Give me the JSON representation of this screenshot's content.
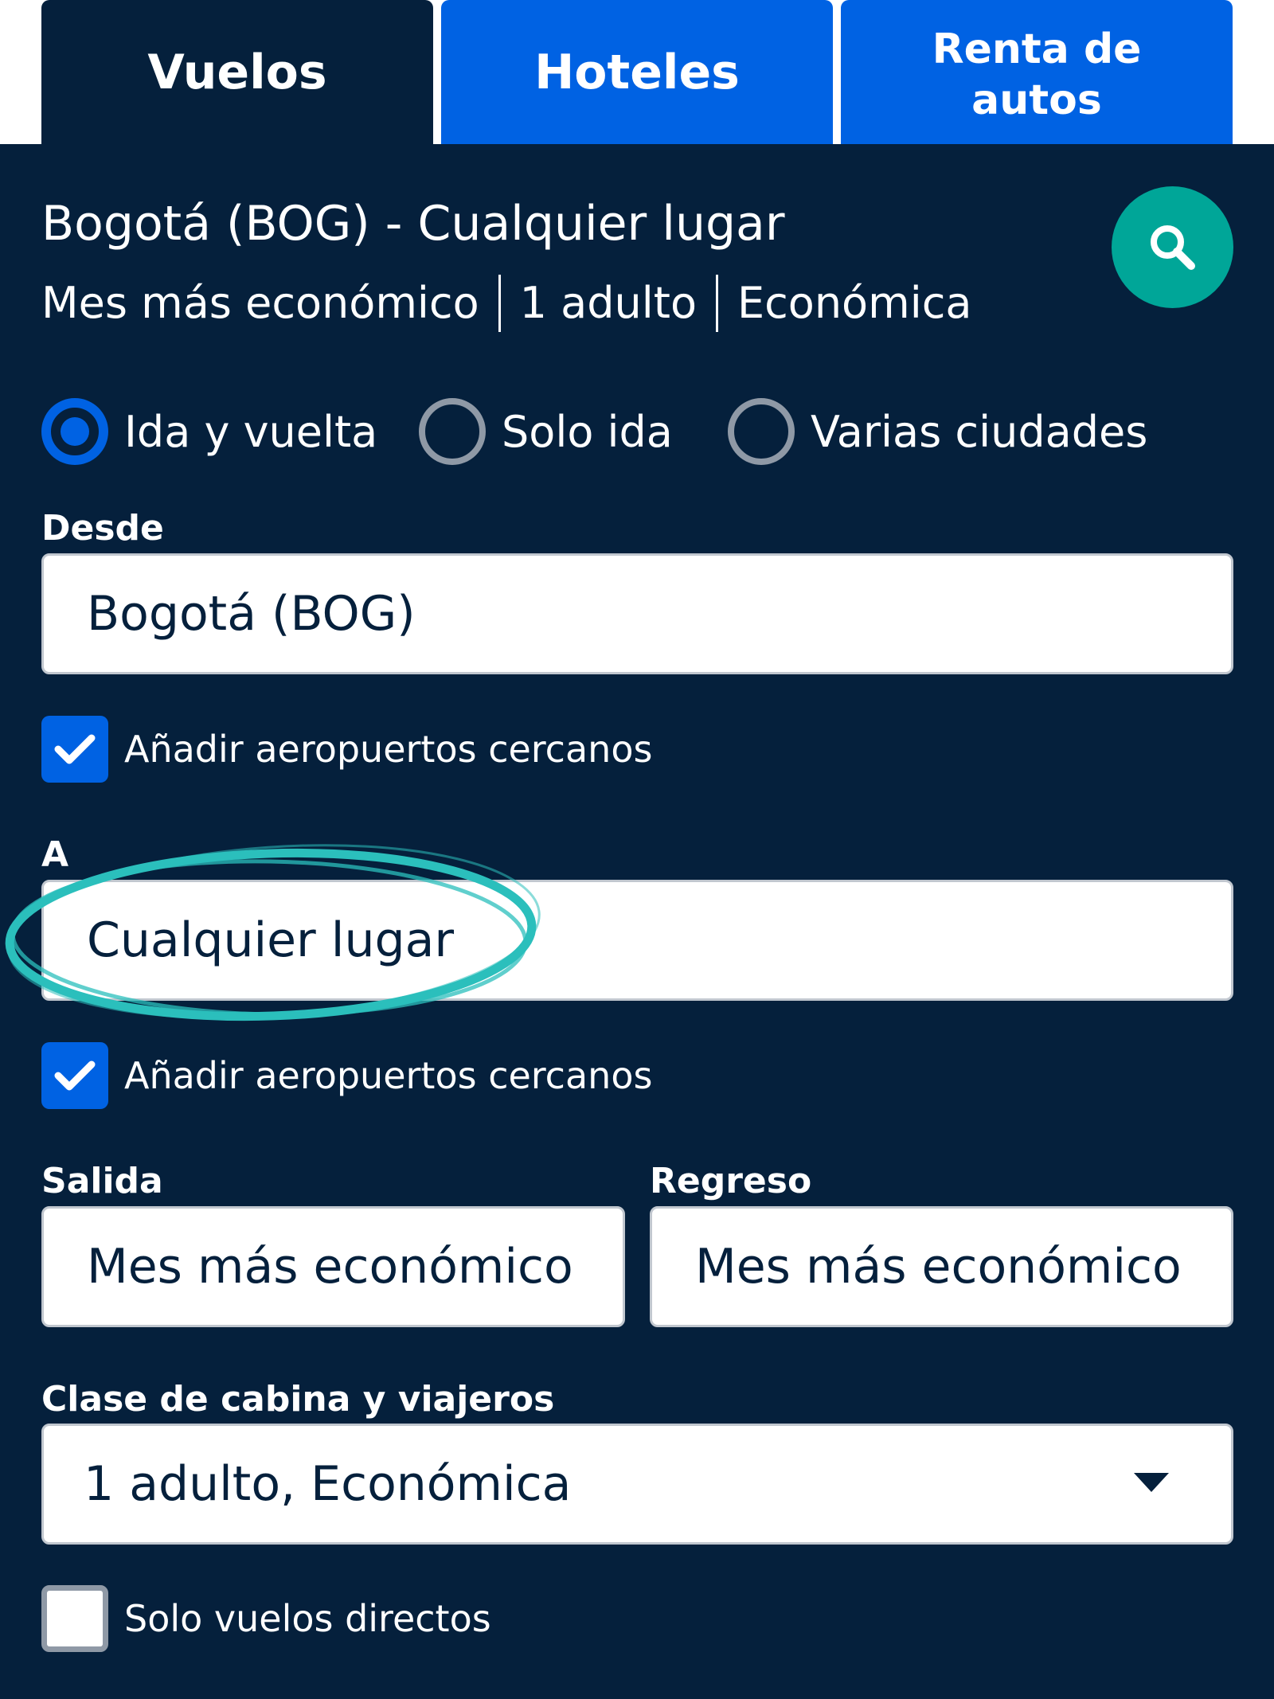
{
  "tabs": [
    {
      "label": "Vuelos",
      "active": true
    },
    {
      "label": "Hoteles",
      "active": false
    },
    {
      "label_line1": "Renta de",
      "label_line2": "autos",
      "active": false
    }
  ],
  "summary": {
    "route": "Bogotá (BOG) - Cualquier lugar",
    "date": "Mes más económico",
    "travellers": "1 adulto",
    "cabin": "Económica"
  },
  "trip_type": {
    "options": [
      "Ida y vuelta",
      "Solo ida",
      "Varias ciudades"
    ],
    "selected": "Ida y vuelta"
  },
  "from": {
    "label": "Desde",
    "value": "Bogotá (BOG)",
    "nearby_label": "Añadir aeropuertos cercanos",
    "nearby_checked": true
  },
  "to": {
    "label": "A",
    "value": "Cualquier lugar",
    "nearby_label": "Añadir aeropuertos cercanos",
    "nearby_checked": true
  },
  "depart": {
    "label": "Salida",
    "value": "Mes más económico"
  },
  "return": {
    "label": "Regreso",
    "value": "Mes más económico"
  },
  "cabin_travellers": {
    "label": "Clase de cabina y viajeros",
    "value": "1 adulto, Económica"
  },
  "direct_only": {
    "label": "Solo vuelos directos",
    "checked": false
  },
  "colors": {
    "navy": "#05203c",
    "blue": "#0062e3",
    "teal": "#00a698",
    "highlight": "#2bbfbc"
  },
  "icons": [
    "search-icon",
    "check-icon",
    "caret-down-icon"
  ]
}
